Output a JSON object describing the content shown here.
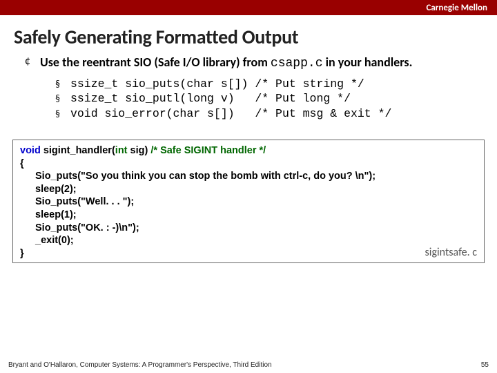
{
  "brand": "Carnegie Mellon",
  "title": "Safely Generating Formatted Output",
  "bullet_prefix": "Use the reentrant SIO (Safe I/O library) from ",
  "bullet_code": "csapp.c",
  "bullet_suffix": " in your handlers.",
  "sio": [
    "ssize_t sio_puts(char s[]) /* Put string */",
    "ssize_t sio_putl(long v)   /* Put long */",
    "void sio_error(char s[])   /* Put msg & exit */"
  ],
  "code": {
    "kw_void": "void",
    "fn_name": "sigint_handler",
    "paren_open": "(",
    "kw_int": "int",
    "param": " sig",
    "paren_close": ")",
    "comment": " /* Safe SIGINT handler */",
    "brace_open": "{",
    "lines": [
      "Sio_puts(\"So you think you can stop the bomb with ctrl-c, do you? \\n\");",
      "sleep(2);",
      "Sio_puts(\"Well. . . \");",
      "sleep(1);",
      "Sio_puts(\"OK. : -)\\n\");",
      "_exit(0);"
    ],
    "brace_close": "}",
    "label": "sigintsafe. c"
  },
  "footer_left": "Bryant and O'Hallaron, Computer Systems: A Programmer's Perspective, Third Edition",
  "footer_right": "55"
}
